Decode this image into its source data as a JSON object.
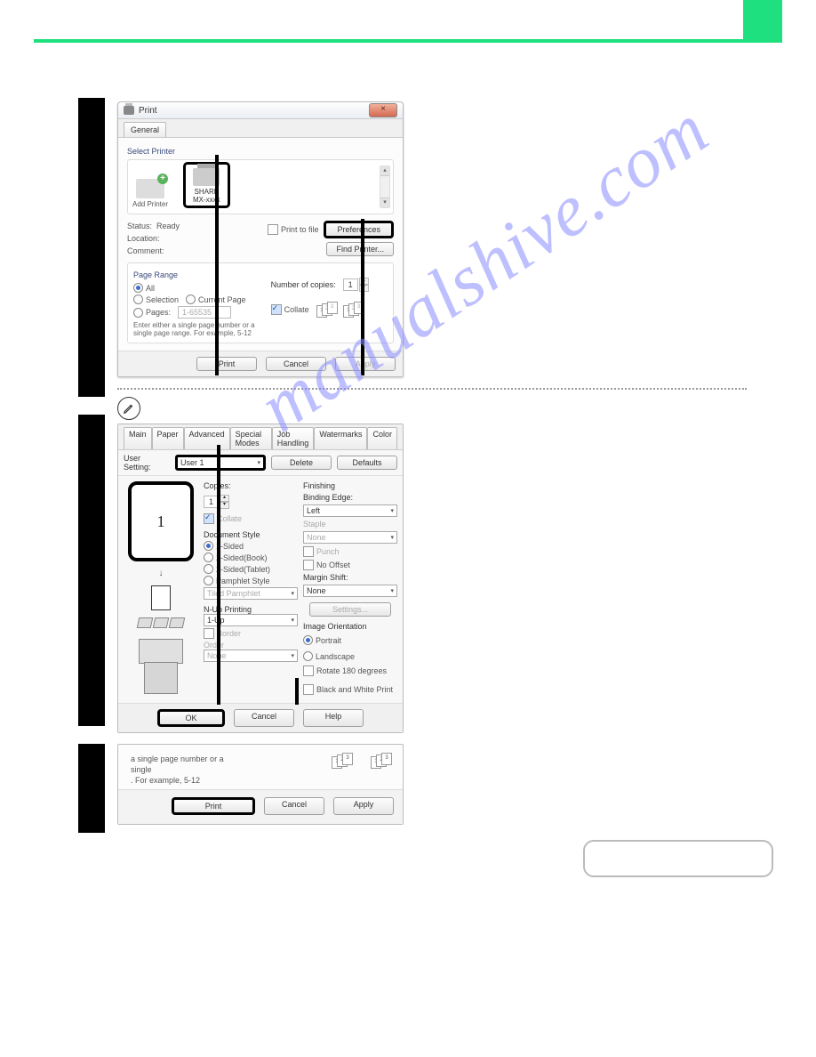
{
  "watermark_text": "manualshive.com",
  "step1": {
    "dialog_title": "Print",
    "close_glyph": "×",
    "tab_general": "General",
    "select_printer_label": "Select Printer",
    "add_printer": "Add Printer",
    "selected_printer_line1": "SHARP",
    "selected_printer_line2": "MX-xxxx",
    "status_label": "Status:",
    "status_value": "Ready",
    "location_label": "Location:",
    "comment_label": "Comment:",
    "print_to_file": "Print to file",
    "preferences_btn": "Preferences",
    "find_printer_btn": "Find Printer...",
    "page_range_label": "Page Range",
    "all_label": "All",
    "selection_label": "Selection",
    "current_page_label": "Current Page",
    "pages_label": "Pages:",
    "pages_value": "1-65535",
    "hint": "Enter either a single page number or a single page range. For example, 5-12",
    "copies_label": "Number of copies:",
    "copies_value": "1",
    "collate_label": "Collate",
    "print_btn": "Print",
    "cancel_btn": "Cancel",
    "apply_btn": "Apply"
  },
  "step2": {
    "tabs": [
      "Main",
      "Paper",
      "Advanced",
      "Special Modes",
      "Job Handling",
      "Watermarks",
      "Color"
    ],
    "user_setting_label": "User Setting:",
    "user_setting_value": "User 1",
    "delete_btn": "Delete",
    "defaults_btn": "Defaults",
    "preview_num": "1",
    "copies_label": "Copies:",
    "copies_value": "1",
    "collate_label": "Collate",
    "doc_style_label": "Document Style",
    "ds_1sided": "1-Sided",
    "ds_2book": "2-Sided(Book)",
    "ds_2tablet": "2-Sided(Tablet)",
    "ds_pamphlet": "Pamphlet Style",
    "tiled_pamphlet": "Tiled Pamphlet",
    "nup_label": "N-Up Printing",
    "nup_value": "1-Up",
    "border_label": "Border",
    "order_label": "Order",
    "order_value": "None",
    "finishing_label": "Finishing",
    "binding_edge_label": "Binding Edge:",
    "binding_edge_value": "Left",
    "staple_label": "Staple",
    "staple_value": "None",
    "punch_label": "Punch",
    "no_offset": "No Offset",
    "margin_shift_label": "Margin Shift:",
    "margin_shift_value": "None",
    "settings_btn": "Settings...",
    "orientation_label": "Image Orientation",
    "portrait": "Portrait",
    "landscape": "Landscape",
    "rotate180": "Rotate 180 degrees",
    "bw_print": "Black and White Print",
    "ok_btn": "OK",
    "cancel_btn": "Cancel",
    "help_btn": "Help"
  },
  "step3": {
    "hint": "a single page number or a single\n.  For example, 5-12",
    "print_btn": "Print",
    "cancel_btn": "Cancel",
    "apply_btn": "Apply"
  }
}
